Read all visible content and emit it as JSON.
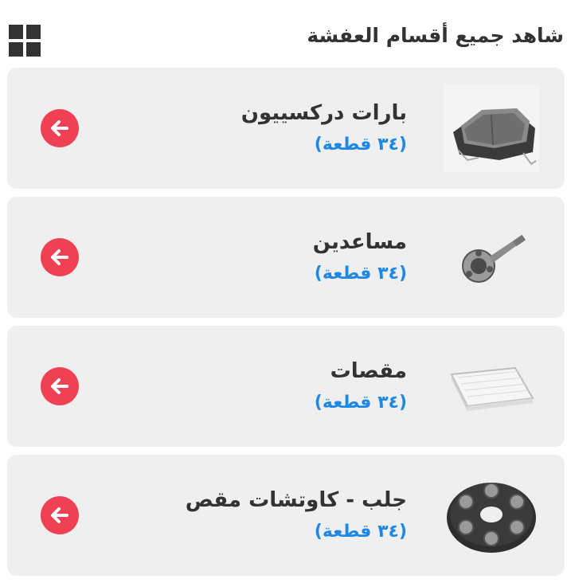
{
  "header": {
    "title": "شاهد جميع أقسام العفشة",
    "view_toggle_icon": "grid-view-icon"
  },
  "categories": [
    {
      "name": "بارات دركسييون",
      "count": "(٣٤ قطعة)",
      "image": "brake-pads-image",
      "action_icon": "arrow-left-icon"
    },
    {
      "name": "مساعدين",
      "count": "(٣٤ قطعة)",
      "image": "cv-joint-image",
      "action_icon": "arrow-left-icon"
    },
    {
      "name": "مقصات",
      "count": "(٣٤ قطعة)",
      "image": "cabin-filter-image",
      "action_icon": "arrow-left-icon"
    },
    {
      "name": "جلب - كاوتشات مقص",
      "count": "(٣٤ قطعة)",
      "image": "flex-disc-image",
      "action_icon": "arrow-left-icon"
    }
  ],
  "colors": {
    "card_background": "#efefef",
    "accent_red": "#ef4054",
    "count_blue": "#1e88e5",
    "text_dark": "#333333"
  }
}
